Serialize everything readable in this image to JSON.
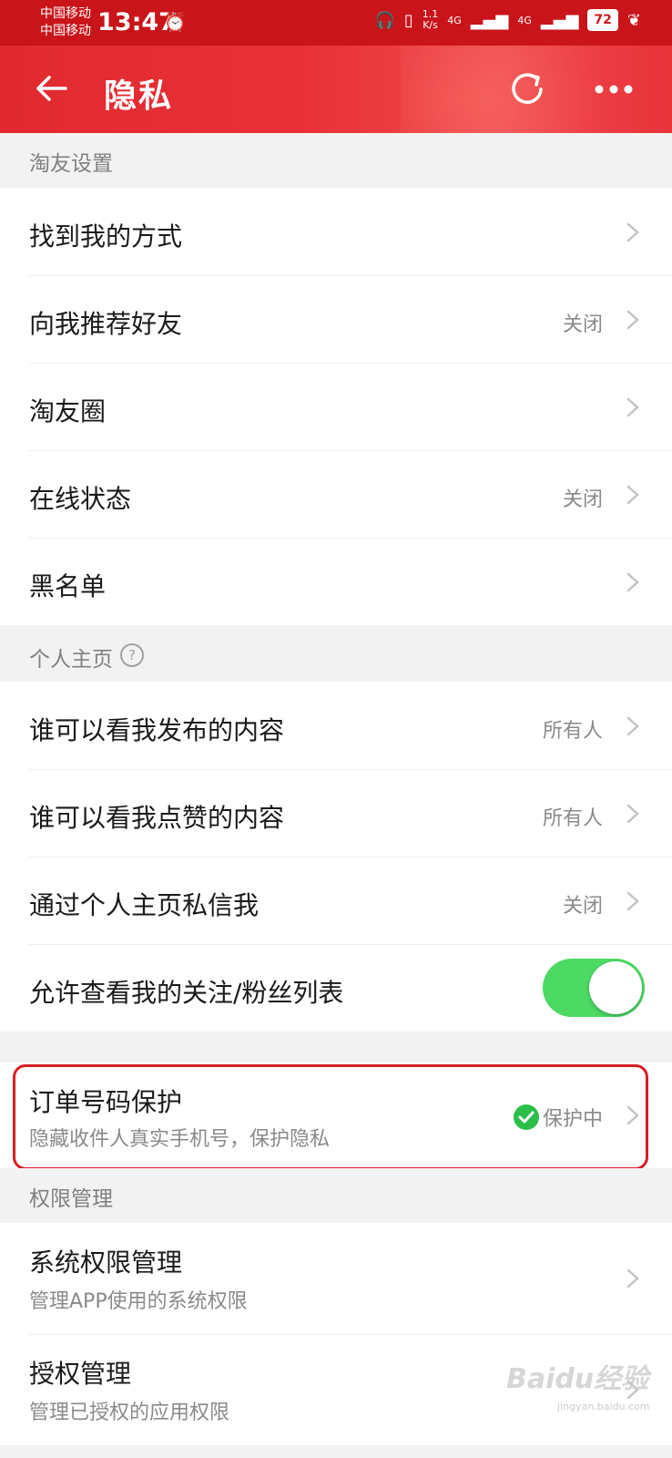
{
  "status_bar": {
    "carrier1": "中国移动",
    "carrier2": "中国移动",
    "time": "13:47",
    "speed_value": "1.1",
    "speed_unit": "K/s",
    "net1": "4G",
    "net2": "4G",
    "battery": "72"
  },
  "header": {
    "title": "隐私",
    "back_icon": "back-arrow-icon",
    "refresh_icon": "refresh-icon",
    "more_icon": "more-dots-icon"
  },
  "sections": {
    "friends": {
      "title": "淘友设置",
      "rows": [
        {
          "label": "找到我的方式",
          "value": ""
        },
        {
          "label": "向我推荐好友",
          "value": "关闭"
        },
        {
          "label": "淘友圈",
          "value": ""
        },
        {
          "label": "在线状态",
          "value": "关闭"
        },
        {
          "label": "黑名单",
          "value": ""
        }
      ]
    },
    "homepage": {
      "title": "个人主页",
      "help_symbol": "?",
      "rows": [
        {
          "label": "谁可以看我发布的内容",
          "value": "所有人"
        },
        {
          "label": "谁可以看我点赞的内容",
          "value": "所有人"
        },
        {
          "label": "通过个人主页私信我",
          "value": "关闭"
        },
        {
          "label": "允许查看我的关注/粉丝列表",
          "toggle_on": true
        }
      ]
    },
    "order": {
      "title": "订单号码保护",
      "subtitle": "隐藏收件人真实手机号，保护隐私",
      "status": "保护中"
    },
    "permissions": {
      "title": "权限管理",
      "rows": [
        {
          "label": "系统权限管理",
          "subtitle": "管理APP使用的系统权限"
        },
        {
          "label": "授权管理",
          "subtitle": "管理已授权的应用权限"
        }
      ]
    }
  },
  "watermark": {
    "brand": "Baidu经验",
    "url": "jingyan.baidu.com"
  },
  "colors": {
    "brand_red": "#e02a2f",
    "toggle_green": "#4cd964",
    "highlight": "#d81e25",
    "check_green": "#2bbf4a"
  }
}
